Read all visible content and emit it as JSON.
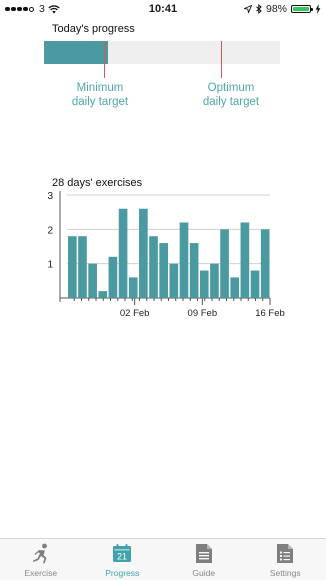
{
  "status_bar": {
    "carrier": "3",
    "time": "10:41",
    "battery_percent": "98%",
    "battery_level": 0.98
  },
  "progress": {
    "title": "Today's progress",
    "fill_fraction": 0.27,
    "minimum_label_line1": "Minimum",
    "minimum_label_line2": "daily target",
    "optimum_label_line1": "Optimum",
    "optimum_label_line2": "daily target",
    "colors": {
      "fill": "#4b9aa1",
      "track": "#efefef",
      "marker": "#d9584f",
      "label": "#4fa7ad"
    }
  },
  "exercise_chart": {
    "title": "28 days' exercises"
  },
  "chart_data": {
    "type": "bar",
    "title": "28 days' exercises",
    "xlabel": "",
    "ylabel": "",
    "ylim": [
      0,
      3
    ],
    "yticks": [
      1,
      2,
      3
    ],
    "xtick_labels": [
      {
        "label": "02 Feb",
        "index": 7
      },
      {
        "label": "09 Feb",
        "index": 14
      },
      {
        "label": "16 Feb",
        "index": 21
      }
    ],
    "values": [
      1.8,
      1.8,
      1.0,
      0.2,
      1.2,
      2.6,
      0.6,
      2.6,
      1.8,
      1.6,
      1.0,
      2.2,
      1.6,
      0.8,
      1.0,
      2.0,
      0.6,
      2.2,
      0.8,
      2.0
    ],
    "grid": true,
    "bar_color": "#4b9aa1"
  },
  "tabbar": {
    "tabs": [
      {
        "label": "Exercise",
        "icon": "runner-icon",
        "active": false
      },
      {
        "label": "Progress",
        "icon": "calendar-icon",
        "active": true,
        "icon_text": "21"
      },
      {
        "label": "Guide",
        "icon": "document-icon",
        "active": false
      },
      {
        "label": "Settings",
        "icon": "list-document-icon",
        "active": false
      }
    ],
    "active_color": "#3fa3a9",
    "inactive_color": "#888888"
  }
}
